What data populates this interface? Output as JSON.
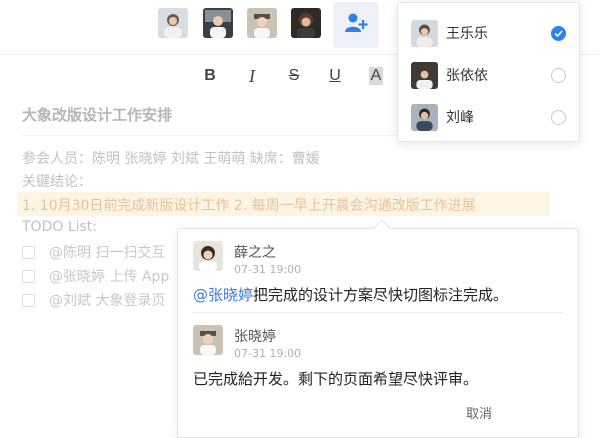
{
  "topbar": {
    "avatars": [
      {
        "icon": "user-avatar-icon"
      },
      {
        "icon": "user-avatar-icon"
      },
      {
        "icon": "user-avatar-icon"
      },
      {
        "icon": "user-avatar-icon"
      }
    ],
    "add_collaborator_icon": "add-user-icon",
    "accent": "#2f80ed"
  },
  "toolbar": {
    "bold": "B",
    "italic": "I",
    "strike": "S",
    "underline": "U",
    "highlight": "A"
  },
  "collaborator_menu": {
    "items": [
      {
        "name": "王乐乐",
        "checked": true
      },
      {
        "name": "张依依",
        "checked": false
      },
      {
        "name": "刘峰",
        "checked": false
      }
    ]
  },
  "document": {
    "title": "大象改版设计工作安排",
    "attendees": "参会人员：陈明 张晓婷 刘斌 王萌萌      缺席：曹媛",
    "conclusions_label": "关键结论：",
    "highlight_line": "1. 10月30日前完成新版设计工作    2. 每周一早上开晨会沟通改版工作进展",
    "todo_label": "TODO List:",
    "todos": [
      "@陈明 扫一扫交互",
      "@张晓婷 上传 App",
      "@刘斌 大象登录页"
    ]
  },
  "comments": {
    "items": [
      {
        "author": "薛之之",
        "time": "07-31 19:00",
        "mention": "@张晓婷",
        "body": "把完成的设计方案尽快切图标注完成。"
      },
      {
        "author": "张晓婷",
        "time": "07-31 19:00",
        "body": "已完成給开发。剩下的页面希望尽快评审。"
      }
    ],
    "cancel_label": "取消"
  }
}
